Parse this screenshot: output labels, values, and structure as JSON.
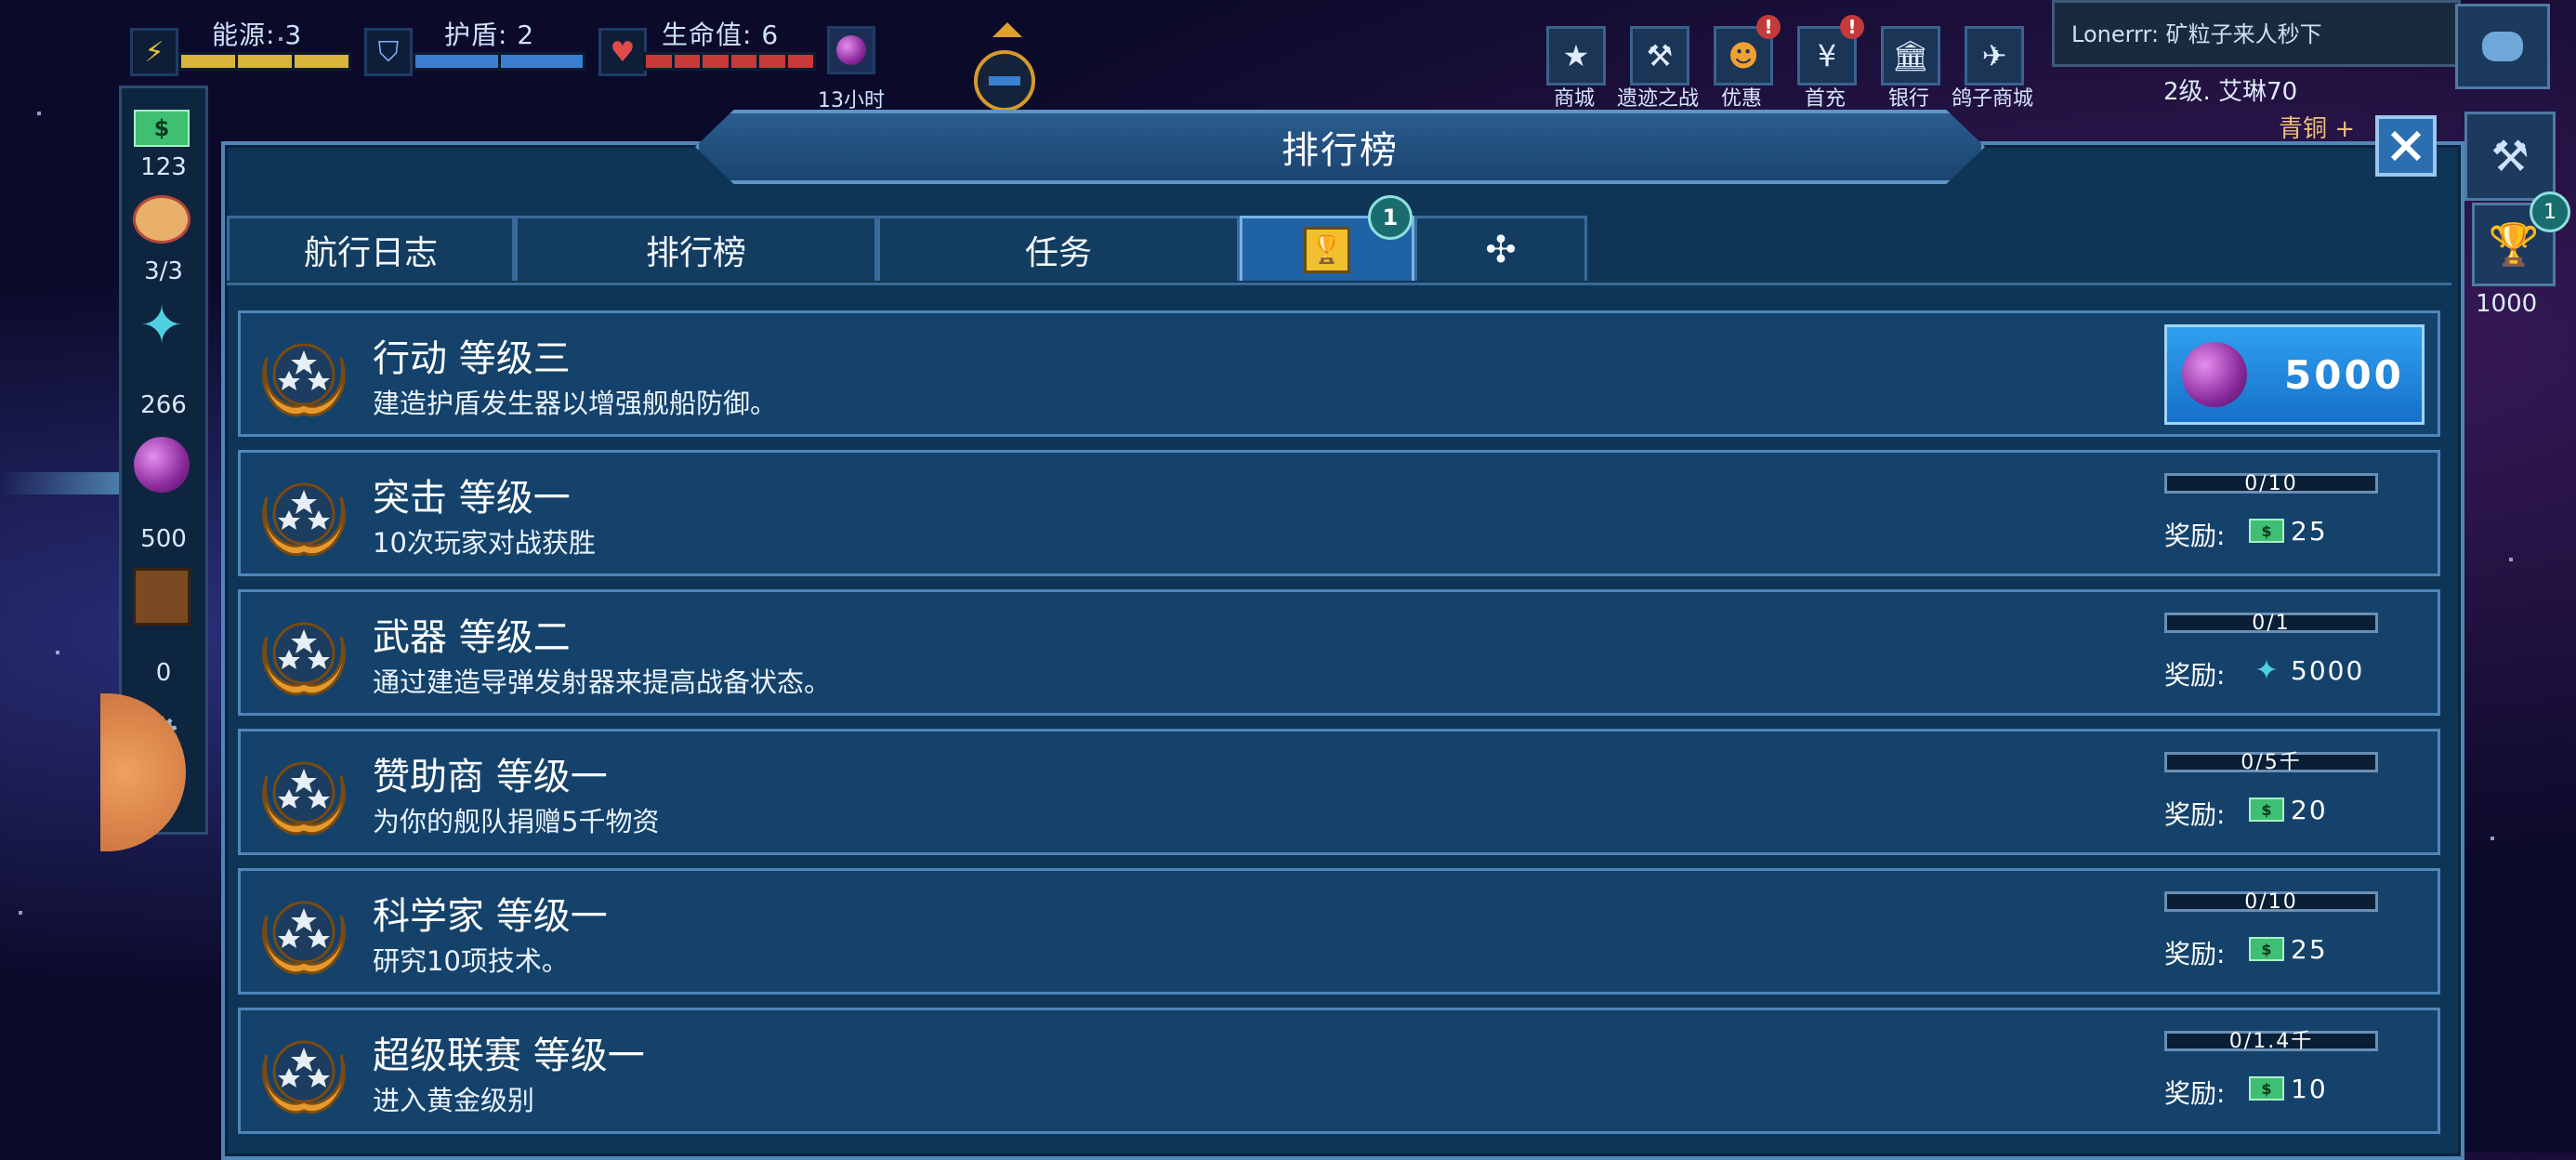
{
  "hud": {
    "energy_label": "能源: 3",
    "shield_label": "护盾: 2",
    "health_label": "生命值: 6",
    "timer": "13小时",
    "colors": {
      "energy": "#d8b43a",
      "shield": "#3a7fd0",
      "health": "#c83a3a"
    }
  },
  "top_buttons": [
    {
      "label": "商城",
      "icon": "star-store-icon",
      "badge": ""
    },
    {
      "label": "遗迹之战",
      "icon": "hammer-icon",
      "badge": ""
    },
    {
      "label": "优惠",
      "icon": "pumpkin-icon",
      "badge": "!"
    },
    {
      "label": "首充",
      "icon": "yen-icon",
      "badge": "!"
    },
    {
      "label": "银行",
      "icon": "bank-icon",
      "badge": ""
    },
    {
      "label": "鸽子商城",
      "icon": "pigeon-icon",
      "badge": ""
    }
  ],
  "chat": {
    "text": "Lonerrr: 矿粒子来人秒下"
  },
  "player": {
    "level_text": "2级. 艾琳70",
    "rank_text": "青铜 +"
  },
  "right_side": {
    "trophy_count": "1000",
    "trophy_badge": "1"
  },
  "left_resources": [
    "123",
    "3/3",
    "266",
    "500",
    "0"
  ],
  "panel": {
    "title": "排行榜",
    "tabs": [
      {
        "label": "航行日志",
        "active": false,
        "icon": ""
      },
      {
        "label": "排行榜",
        "active": false,
        "icon": ""
      },
      {
        "label": "任务",
        "active": false,
        "icon": ""
      },
      {
        "label": "",
        "active": true,
        "icon": "trophy-icon"
      },
      {
        "label": "",
        "active": false,
        "icon": "sparkle-icon"
      }
    ],
    "trophy_tab_badge": "1"
  },
  "achievements": [
    {
      "title": "行动 等级三",
      "desc": "建造护盾发生器以增强舰船防御。",
      "claim": true,
      "claim_amount": "5000",
      "claim_icon": "orb-icon",
      "progress": "",
      "progress_fraction": 1.0,
      "reward_label": "",
      "reward_icon": "",
      "reward_value": ""
    },
    {
      "title": "突击 等级一",
      "desc": "10次玩家对战获胜",
      "claim": false,
      "progress": "0/10",
      "progress_fraction": 0,
      "reward_label": "奖励:",
      "reward_icon": "cash-icon",
      "reward_value": "25"
    },
    {
      "title": "武器 等级二",
      "desc": "通过建造导弹发射器来提高战备状态。",
      "claim": false,
      "progress": "0/1",
      "progress_fraction": 0,
      "reward_label": "奖励:",
      "reward_icon": "crystal-icon",
      "reward_value": "5000"
    },
    {
      "title": "赞助商 等级一",
      "desc": "为你的舰队捐赠5千物资",
      "claim": false,
      "progress": "0/5千",
      "progress_fraction": 0,
      "reward_label": "奖励:",
      "reward_icon": "cash-icon",
      "reward_value": "20"
    },
    {
      "title": "科学家 等级一",
      "desc": "研究10项技术。",
      "claim": false,
      "progress": "0/10",
      "progress_fraction": 0,
      "reward_label": "奖励:",
      "reward_icon": "cash-icon",
      "reward_value": "25"
    },
    {
      "title": "超级联赛 等级一",
      "desc": "进入黄金级别",
      "claim": false,
      "progress": "0/1.4千",
      "progress_fraction": 0,
      "reward_label": "奖励:",
      "reward_icon": "cash-icon",
      "reward_value": "10"
    }
  ]
}
